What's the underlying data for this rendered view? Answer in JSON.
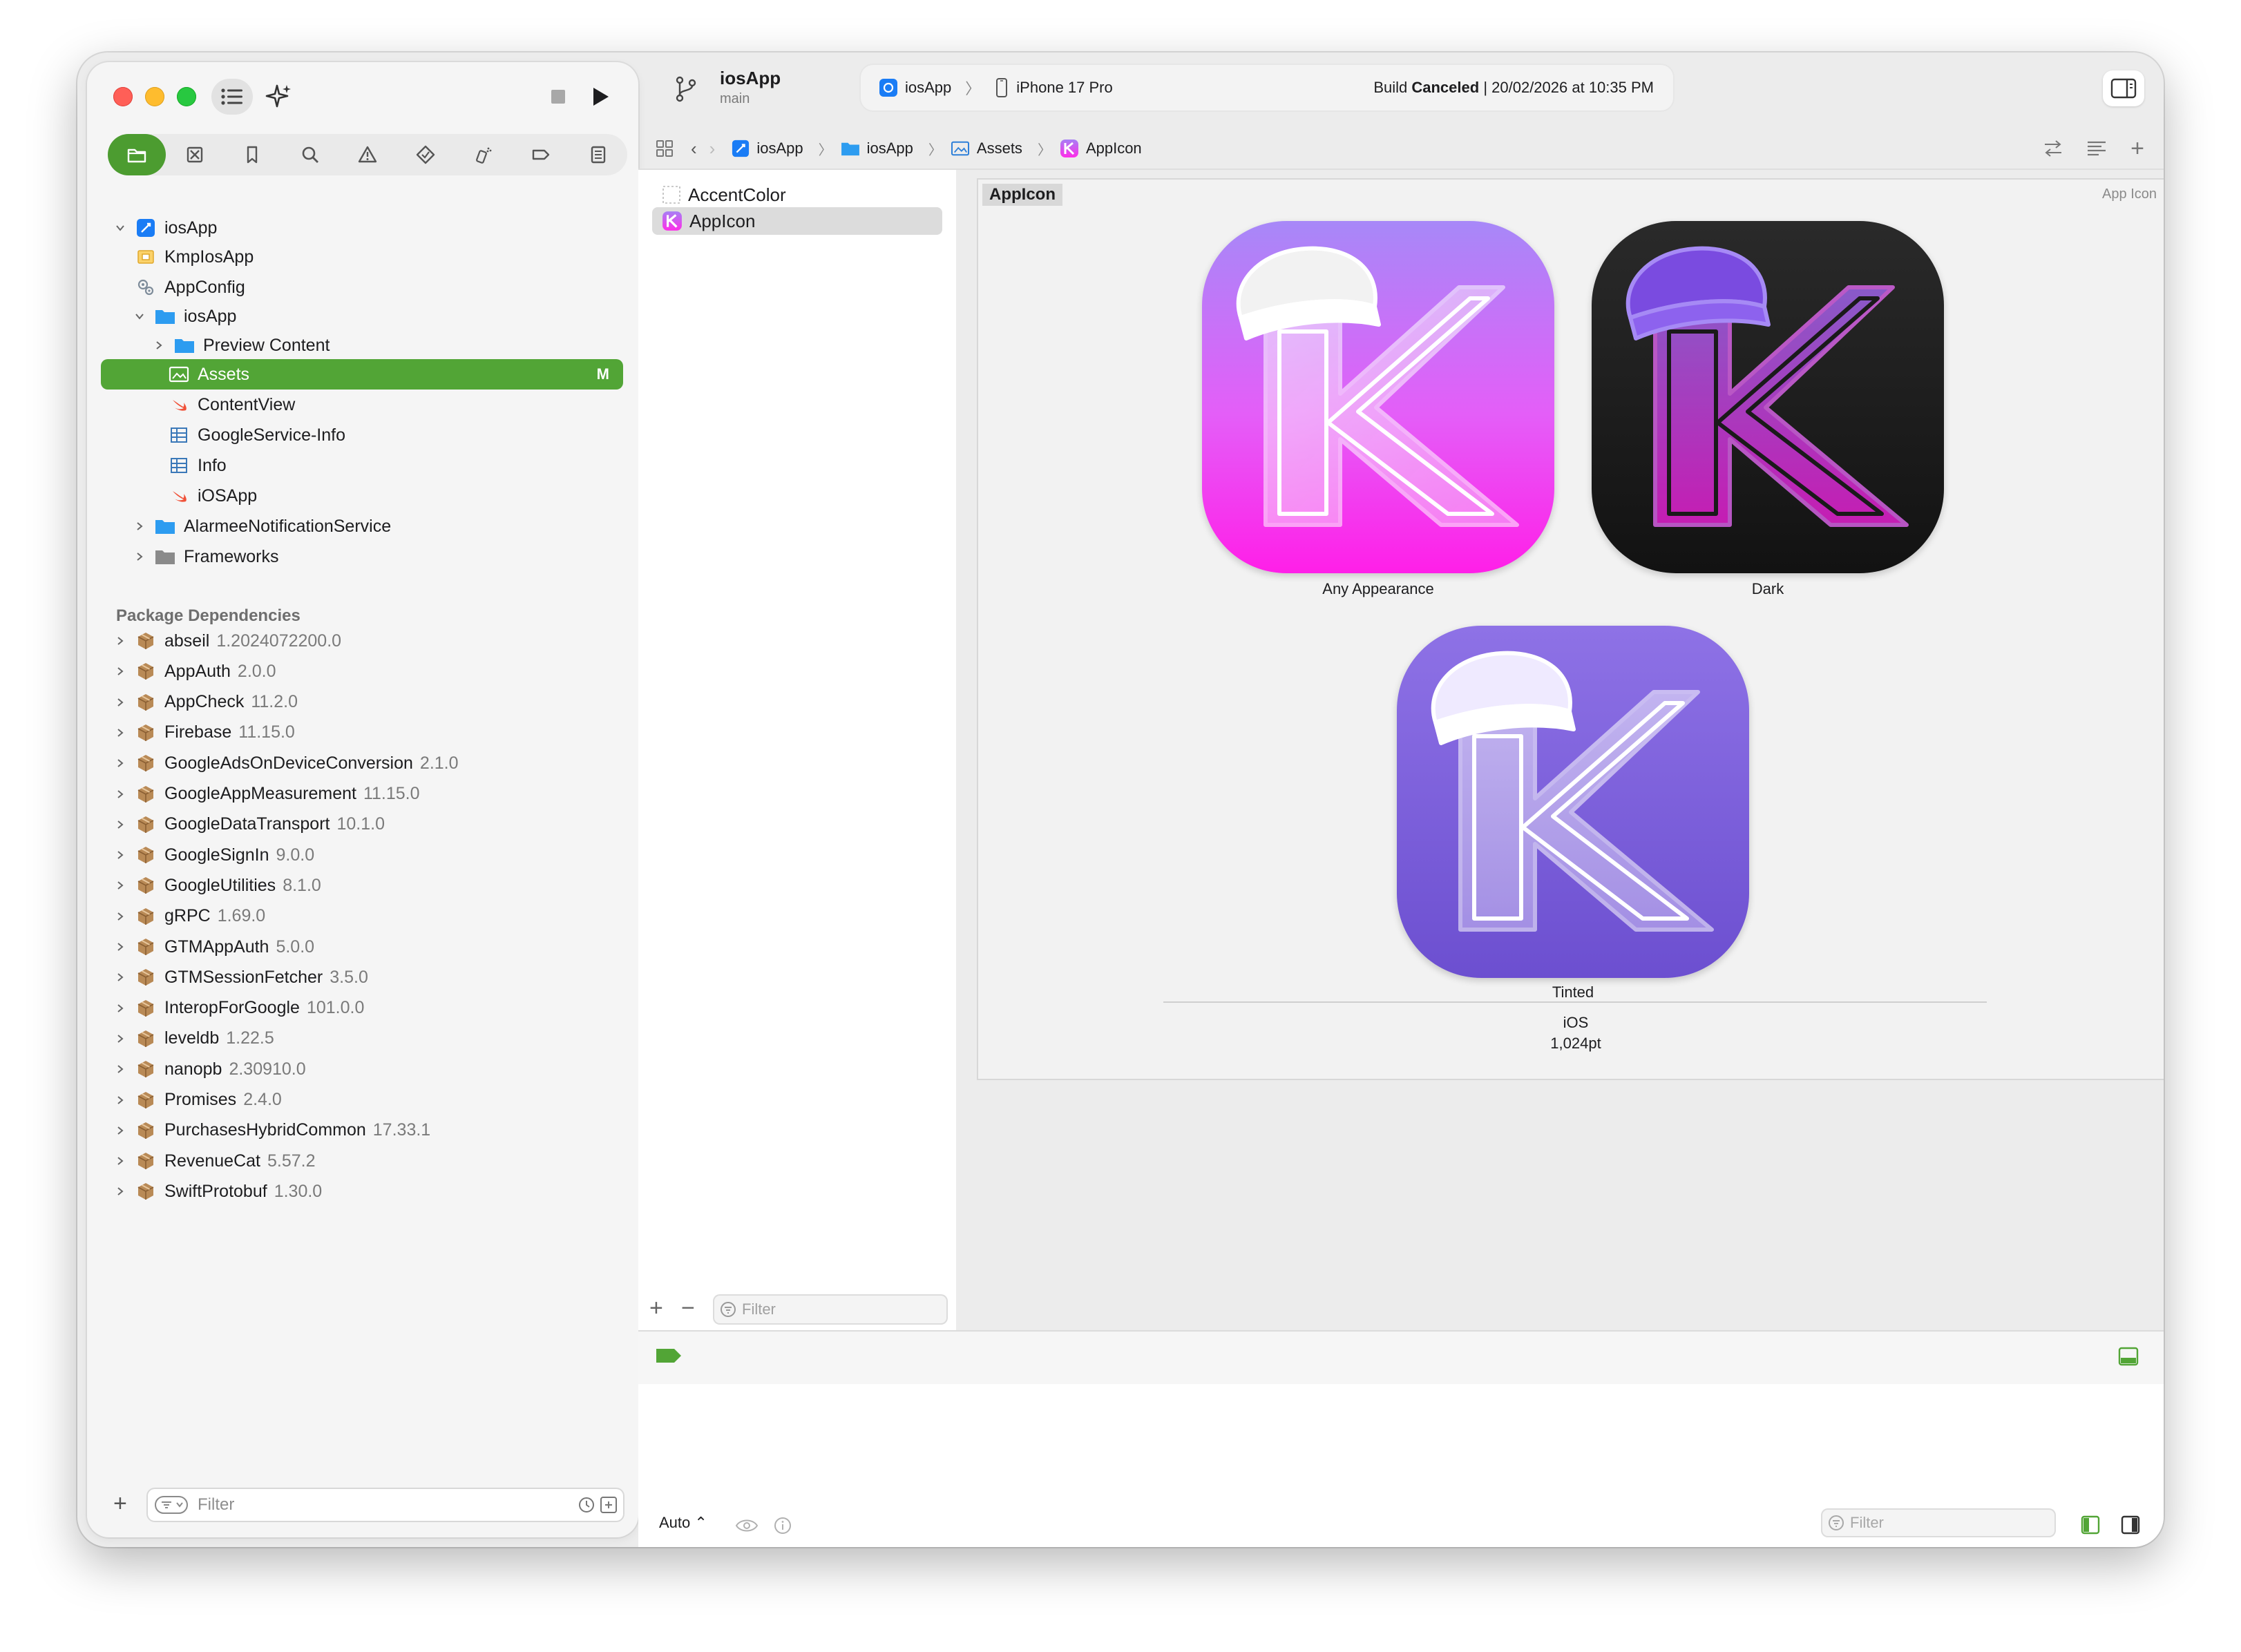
{
  "toolbar": {
    "project_name": "iosApp",
    "branch": "main",
    "scheme": "iosApp",
    "device": "iPhone 17 Pro",
    "build_status_prefix": "Build ",
    "build_status_bold": "Canceled",
    "build_status_suffix": " | 20/02/2026 at 10:35 PM"
  },
  "jumpbar": {
    "items": [
      "iosApp",
      "iosApp",
      "Assets",
      "AppIcon"
    ]
  },
  "navigator": {
    "tree": [
      {
        "label": "iosApp"
      },
      {
        "label": "KmpIosApp"
      },
      {
        "label": "AppConfig"
      },
      {
        "label": "iosApp"
      },
      {
        "label": "Preview Content"
      },
      {
        "label": "Assets",
        "badge": "M"
      },
      {
        "label": "ContentView"
      },
      {
        "label": "GoogleService-Info"
      },
      {
        "label": "Info"
      },
      {
        "label": "iOSApp"
      },
      {
        "label": "AlarmeeNotificationService"
      },
      {
        "label": "Frameworks"
      }
    ],
    "package_header": "Package Dependencies",
    "packages": [
      {
        "name": "abseil",
        "version": "1.2024072200.0"
      },
      {
        "name": "AppAuth",
        "version": "2.0.0"
      },
      {
        "name": "AppCheck",
        "version": "11.2.0"
      },
      {
        "name": "Firebase",
        "version": "11.15.0"
      },
      {
        "name": "GoogleAdsOnDeviceConversion",
        "version": "2.1.0"
      },
      {
        "name": "GoogleAppMeasurement",
        "version": "11.15.0"
      },
      {
        "name": "GoogleDataTransport",
        "version": "10.1.0"
      },
      {
        "name": "GoogleSignIn",
        "version": "9.0.0"
      },
      {
        "name": "GoogleUtilities",
        "version": "8.1.0"
      },
      {
        "name": "gRPC",
        "version": "1.69.0"
      },
      {
        "name": "GTMAppAuth",
        "version": "5.0.0"
      },
      {
        "name": "GTMSessionFetcher",
        "version": "3.5.0"
      },
      {
        "name": "InteropForGoogle",
        "version": "101.0.0"
      },
      {
        "name": "leveldb",
        "version": "1.22.5"
      },
      {
        "name": "nanopb",
        "version": "2.30910.0"
      },
      {
        "name": "Promises",
        "version": "2.4.0"
      },
      {
        "name": "PurchasesHybridCommon",
        "version": "17.33.1"
      },
      {
        "name": "RevenueCat",
        "version": "5.57.2"
      },
      {
        "name": "SwiftProtobuf",
        "version": "1.30.0"
      }
    ],
    "filter_placeholder": "Filter"
  },
  "asset_list": {
    "items": [
      "AccentColor",
      "AppIcon"
    ],
    "filter_placeholder": "Filter"
  },
  "editor": {
    "set_name": "AppIcon",
    "set_type": "App Icon",
    "variants": [
      "Any Appearance",
      "Dark",
      "Tinted"
    ],
    "platform": "iOS",
    "size": "1,024pt"
  },
  "console": {
    "auto_label": "Auto ⌃",
    "filter_placeholder": "Filter"
  },
  "colors": {
    "accent_green": "#52a536",
    "icon_pink": "#ff2df0",
    "icon_purple": "#9b7cf2",
    "tinted_purple": "#7a5ed6"
  }
}
